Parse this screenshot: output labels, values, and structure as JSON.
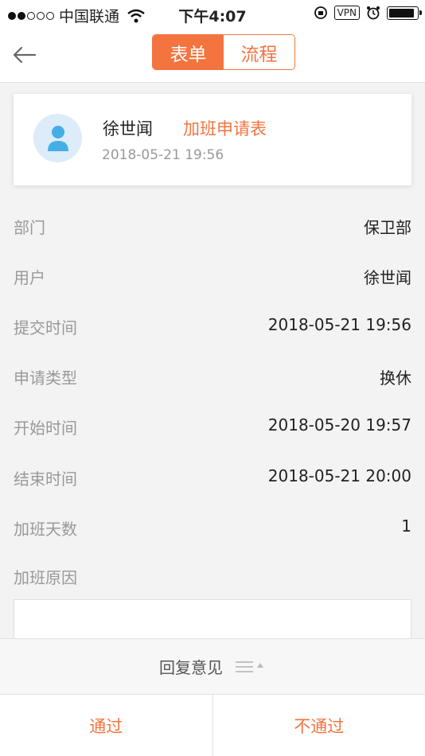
{
  "status_bar": {
    "carrier": "中国联通",
    "time": "下午4:07",
    "vpn": "VPN",
    "battery_level": 0.9
  },
  "nav": {
    "tabs": [
      {
        "label": "表单",
        "active": true
      },
      {
        "label": "流程",
        "active": false
      }
    ]
  },
  "card": {
    "name": "徐世闻",
    "form_type": "加班申请表",
    "time": "2018-05-21 19:56"
  },
  "fields": [
    {
      "label": "部门",
      "value": "保卫部"
    },
    {
      "label": "用户",
      "value": "徐世闻"
    },
    {
      "label": "提交时间",
      "value": "2018-05-21 19:56"
    },
    {
      "label": "申请类型",
      "value": "换休"
    },
    {
      "label": "开始时间",
      "value": "2018-05-20 19:57"
    },
    {
      "label": "结束时间",
      "value": "2018-05-21 20:00"
    },
    {
      "label": "加班天数",
      "value": "1"
    },
    {
      "label": "加班原因",
      "value": ""
    }
  ],
  "reply": {
    "label": "回复意见"
  },
  "actions": {
    "approve": "通过",
    "reject": "不通过"
  },
  "colors": {
    "accent": "#f3743f",
    "label_gray": "#999999"
  }
}
